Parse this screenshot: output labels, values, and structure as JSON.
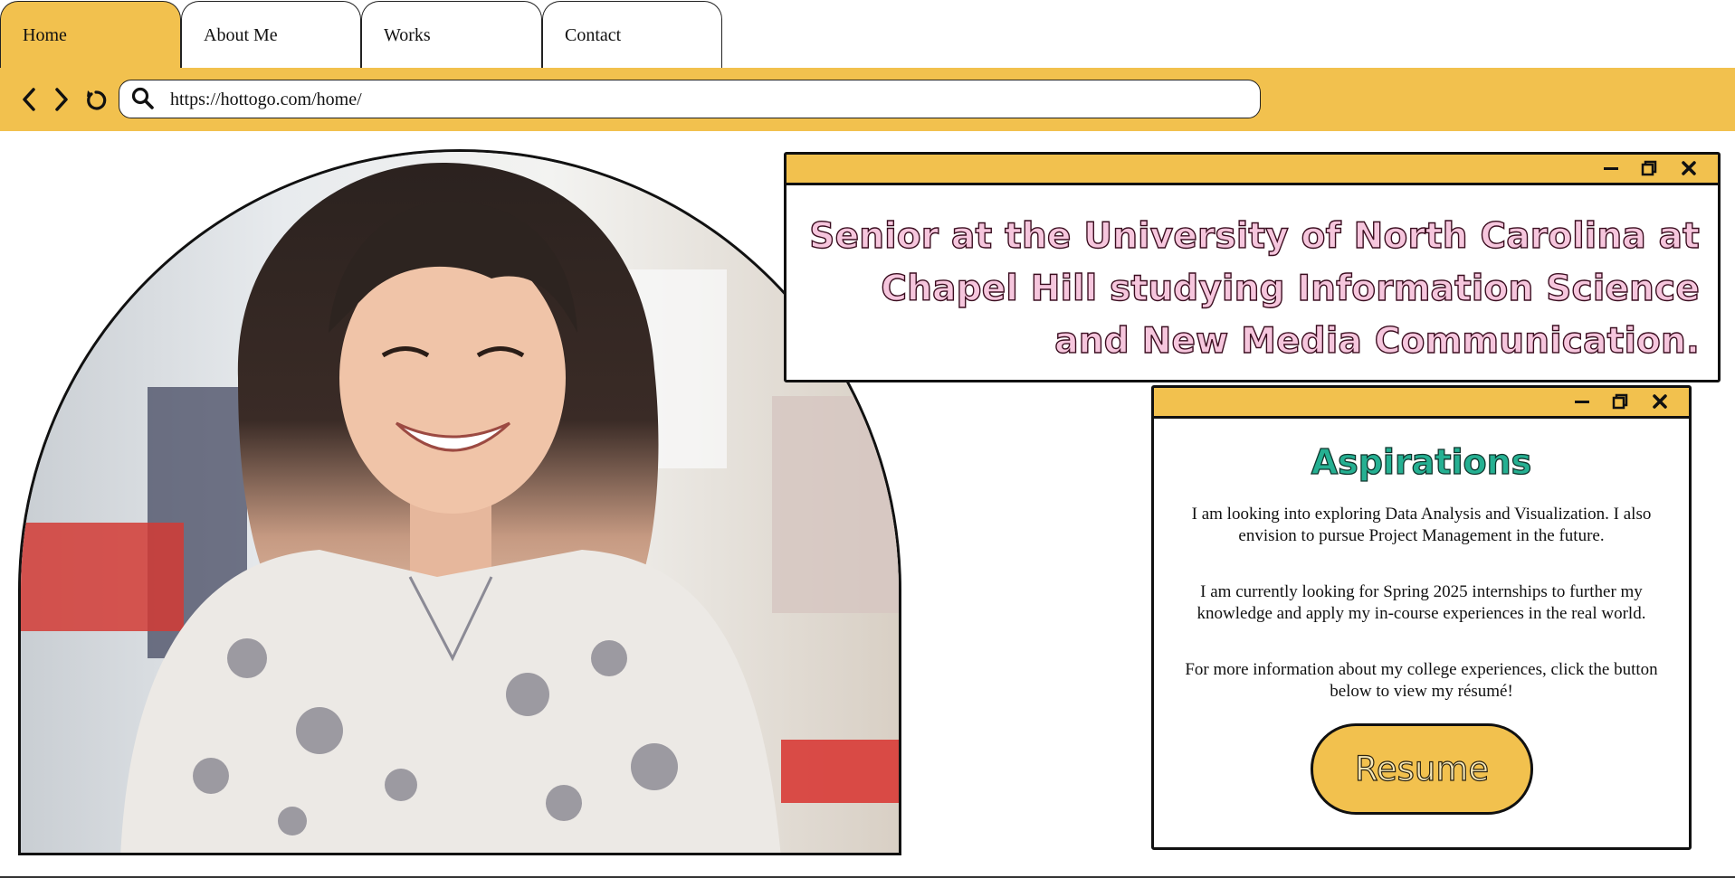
{
  "tabs": [
    {
      "label": "Home",
      "active": true
    },
    {
      "label": "About Me",
      "active": false
    },
    {
      "label": "Works",
      "active": false
    },
    {
      "label": "Contact",
      "active": false
    }
  ],
  "address_bar": {
    "url": "https://hottogo.com/home/"
  },
  "headline_window": {
    "text": "Senior at the University of North Carolina at Chapel Hill studying Information Science and New Media Communication."
  },
  "aspirations_window": {
    "title": "Aspirations",
    "paragraphs": [
      "I am looking into exploring Data Analysis and Visualization. I also envision to pursue Project Management in the future.",
      "I am currently looking for Spring 2025 internships to further my knowledge and apply my in-course experiences in the real world.",
      "For more information about my college experiences, click the button below to view my résumé!"
    ],
    "button_label": "Resume"
  },
  "colors": {
    "accent": "#f2c14e",
    "headline_fill": "#f6c6dd",
    "title_fill": "#25b092"
  }
}
